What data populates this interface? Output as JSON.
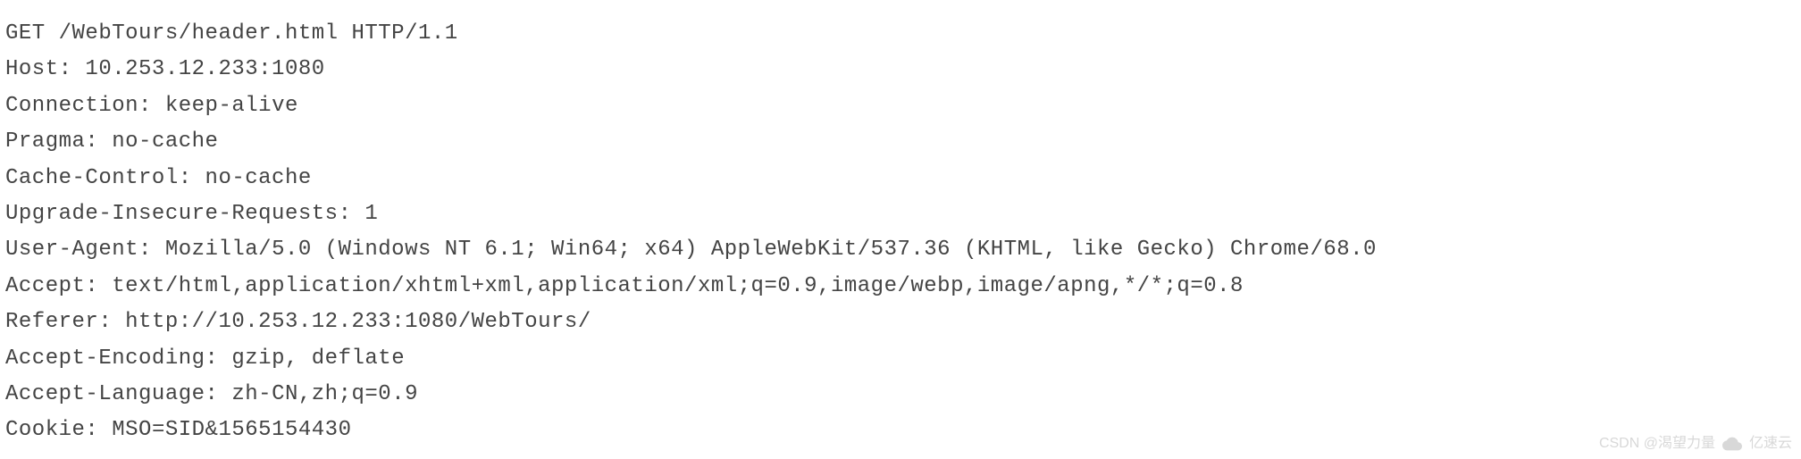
{
  "http": {
    "request_line": "GET /WebTours/header.html HTTP/1.1",
    "headers": {
      "host": {
        "name": "Host",
        "value": "10.253.12.233:1080"
      },
      "connection": {
        "name": "Connection",
        "value": "keep-alive"
      },
      "pragma": {
        "name": "Pragma",
        "value": "no-cache"
      },
      "cache_control": {
        "name": "Cache-Control",
        "value": "no-cache"
      },
      "upgr_insec": {
        "name": "Upgrade-Insecure-Requests",
        "value": "1"
      },
      "user_agent": {
        "name": "User-Agent",
        "value": "Mozilla/5.0 (Windows NT 6.1; Win64; x64) AppleWebKit/537.36 (KHTML, like Gecko) Chrome/68.0"
      },
      "accept": {
        "name": "Accept",
        "value": "text/html,application/xhtml+xml,application/xml;q=0.9,image/webp,image/apng,*/*;q=0.8"
      },
      "referer": {
        "name": "Referer",
        "value": "http://10.253.12.233:1080/WebTours/"
      },
      "accept_encoding": {
        "name": "Accept-Encoding",
        "value": "gzip, deflate"
      },
      "accept_language": {
        "name": "Accept-Language",
        "value": "zh-CN,zh;q=0.9"
      },
      "cookie": {
        "name": "Cookie",
        "value": "MSO=SID&1565154430"
      }
    }
  },
  "watermark": {
    "csdn": "CSDN @渴望力量",
    "brand": "亿速云"
  }
}
